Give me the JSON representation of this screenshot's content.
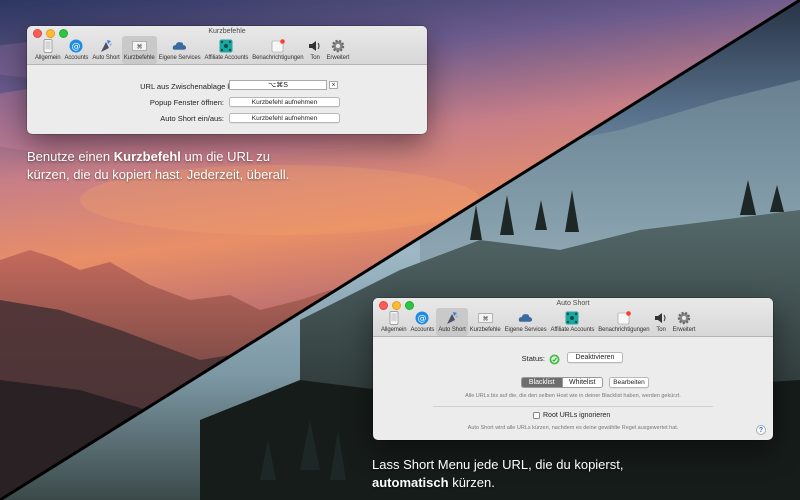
{
  "window1": {
    "title": "Kurzbefehle",
    "tabs": [
      {
        "label": "Allgemein",
        "icon": "phone-icon"
      },
      {
        "label": "Accounts",
        "icon": "at-sign-icon"
      },
      {
        "label": "Auto Short",
        "icon": "wizard-icon"
      },
      {
        "label": "Kurzbefehle",
        "icon": "keyboard-icon"
      },
      {
        "label": "Eigene Services",
        "icon": "cloud-icon"
      },
      {
        "label": "Affiliate Accounts",
        "icon": "network-icon"
      },
      {
        "label": "Benachrichtigungen",
        "icon": "notification-icon"
      },
      {
        "label": "Ton",
        "icon": "speaker-icon"
      },
      {
        "label": "Erweitert",
        "icon": "gear-icon"
      }
    ],
    "active_tab": "Kurzbefehle",
    "rows": [
      {
        "label": "URL aus Zwischenablage kürzen:",
        "value": "⌥⌘S",
        "clear": "×"
      },
      {
        "label": "Popup Fenster öffnen:",
        "button": "Kurzbefehl aufnehmen"
      },
      {
        "label": "Auto Short ein/aus:",
        "button": "Kurzbefehl aufnehmen"
      }
    ]
  },
  "window2": {
    "title": "Auto Short",
    "tabs": [
      {
        "label": "Allgemein",
        "icon": "phone-icon"
      },
      {
        "label": "Accounts",
        "icon": "at-sign-icon"
      },
      {
        "label": "Auto Short",
        "icon": "wizard-icon"
      },
      {
        "label": "Kurzbefehle",
        "icon": "keyboard-icon"
      },
      {
        "label": "Eigene Services",
        "icon": "cloud-icon"
      },
      {
        "label": "Affiliate Accounts",
        "icon": "network-icon"
      },
      {
        "label": "Benachrichtigungen",
        "icon": "notification-icon"
      },
      {
        "label": "Ton",
        "icon": "speaker-icon"
      },
      {
        "label": "Erweitert",
        "icon": "gear-icon"
      }
    ],
    "active_tab": "Auto Short",
    "status_label": "Status:",
    "status_button": "Deaktivieren",
    "rule_label": "Regel:",
    "rule_options": [
      "Blacklist",
      "Whitelist"
    ],
    "rule_selected": "Blacklist",
    "edit_button": "Bearbeiten",
    "rule_hint": "Alle URLs bis auf die, die den selben Host wie in deiner Blacklist haben, werden gekürzt.",
    "root_checkbox": "Root URLs ignorieren",
    "root_hint": "Auto Short wird alle URLs kürzen, nachdem es deine gewählte Regel ausgewertet hat.",
    "help": "?"
  },
  "caption1": {
    "before": "Benutze einen ",
    "bold": "Kurzbefehl",
    "after1": " um die URL zu",
    "line2": "kürzen, die du kopiert hast. Jederzeit, überall."
  },
  "caption2": {
    "line1": "Lass Short Menu jede URL, die du kopierst,",
    "bold": "automatisch",
    "after": " kürzen."
  },
  "colors": {
    "status_green": "#3fbf3f",
    "segment_selected": "#6e6e6e",
    "notification_badge": "#ff3b30"
  }
}
